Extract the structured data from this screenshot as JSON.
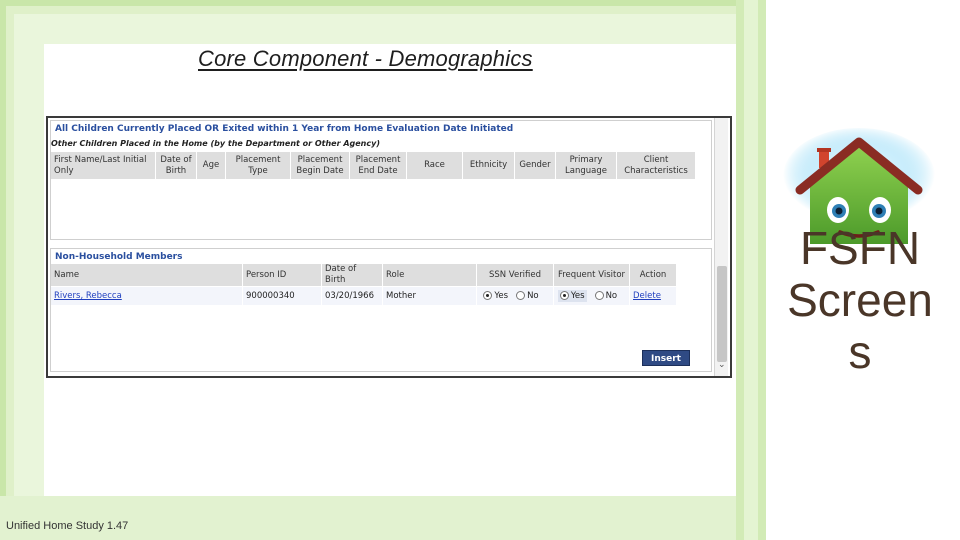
{
  "slide": {
    "title": "Core Component - Demographics",
    "footer": "Unified Home Study 1.47",
    "side_text_line1": "FSFN",
    "side_text_line2": "Screen",
    "side_text_line3": "s"
  },
  "screenshot": {
    "section1": {
      "title": "All Children Currently Placed OR Exited within 1 Year from Home Evaluation Date Initiated",
      "subtitle": "Other Children Placed in the Home (by the Department or Other Agency)",
      "columns": [
        "First Name/Last Initial Only",
        "Date of Birth",
        "Age",
        "Placement Type",
        "Placement Begin Date",
        "Placement End Date",
        "Race",
        "Ethnicity",
        "Gender",
        "Primary Language",
        "Client Characteristics"
      ]
    },
    "section2": {
      "title": "Non-Household Members",
      "columns": [
        "Name",
        "Person ID",
        "Date of Birth",
        "Role",
        "SSN Verified",
        "Frequent Visitor",
        "Action"
      ],
      "row": {
        "name": "Rivers, Rebecca",
        "person_id": "900000340",
        "dob": "03/20/1966",
        "role": "Mother",
        "ssn_yes": "Yes",
        "ssn_no": "No",
        "visitor_yes": "Yes",
        "visitor_no": "No",
        "action": "Delete"
      },
      "ssn_verified_value": "Yes",
      "frequent_visitor_value": "Yes"
    },
    "insert_button": "Insert"
  },
  "colors": {
    "frame_green": "#c9e6a9",
    "section_title_blue": "#2a4f9f",
    "button_navy": "#2f4a84",
    "side_text_brown": "#4a3628"
  },
  "icons": {
    "house": "cartoon-house-icon",
    "scroll_down": "chevron-down-icon"
  }
}
